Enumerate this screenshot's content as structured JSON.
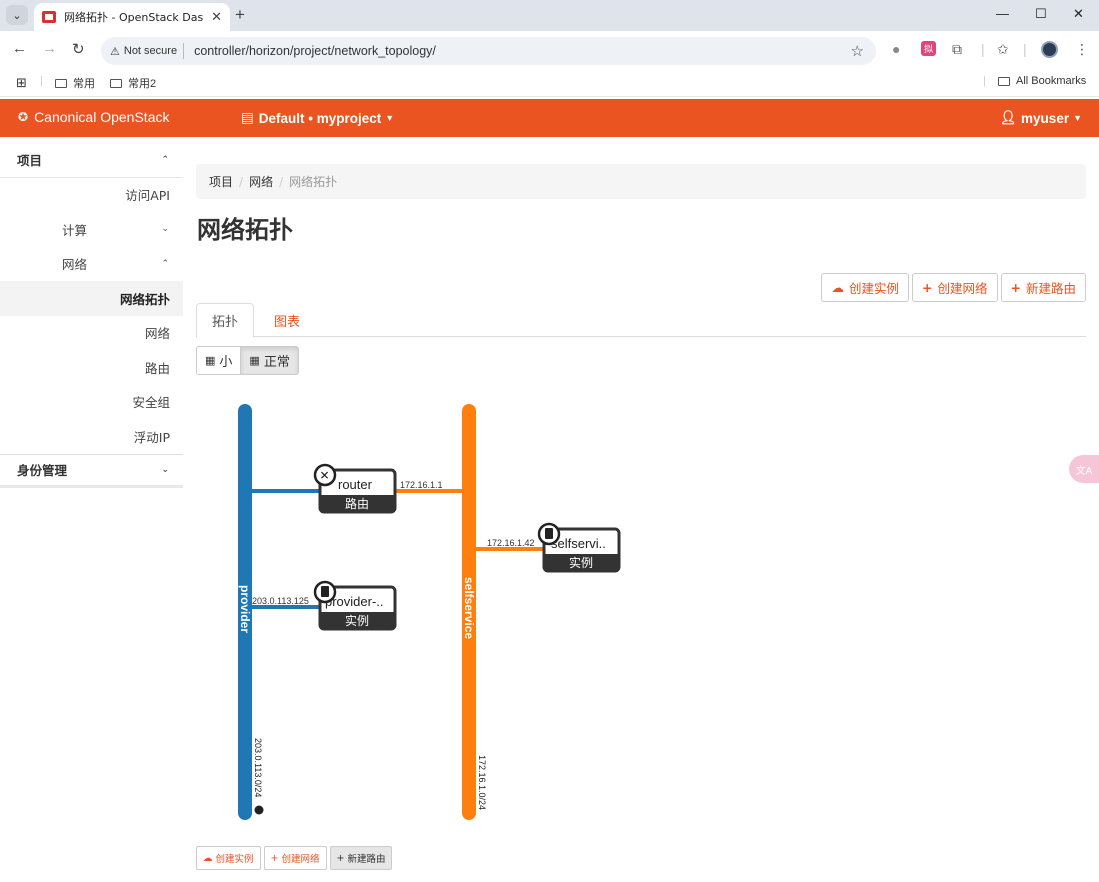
{
  "browser": {
    "tab_title": "网络拓扑 - OpenStack Dashbo",
    "url": "controller/horizon/project/network_topology/",
    "security_label": "Not secure",
    "bookmarks": [
      "常用",
      "常用2"
    ],
    "all_bookmarks": "All Bookmarks",
    "ext_badge": "拟"
  },
  "navbar": {
    "brand": "Canonical OpenStack",
    "project": "Default • myproject",
    "user": "myuser",
    "color": "#e95420"
  },
  "sidebar": {
    "project": "项目",
    "api_access": "访问API",
    "compute": "计算",
    "network": "网络",
    "network_topology": "网络拓扑",
    "networks": "网络",
    "routers": "路由",
    "security_groups": "安全组",
    "floating_ips": "浮动IP",
    "identity": "身份管理"
  },
  "breadcrumb": [
    "项目",
    "网络",
    "网络拓扑"
  ],
  "page_title": "网络拓扑",
  "actions": {
    "create_instance": "创建实例",
    "create_network": "创建网络",
    "create_router": "新建路由"
  },
  "tabs": {
    "topology": "拓扑",
    "graph": "图表"
  },
  "view_toggle": {
    "small": "小",
    "normal": "正常"
  },
  "topology": {
    "networks": [
      {
        "name": "provider",
        "cidr": "203.0.113.0/24",
        "color": "#1f77b4"
      },
      {
        "name": "selfservice",
        "cidr": "172.16.1.0/24",
        "color": "#ff7f0e"
      }
    ],
    "router": {
      "name": "router",
      "type": "路由",
      "ip": "172.16.1.1"
    },
    "instances": [
      {
        "name": "provider-..",
        "type": "实例",
        "ip": "203.0.113.125"
      },
      {
        "name": "selfservi..",
        "type": "实例",
        "ip": "172.16.1.42"
      }
    ]
  },
  "bottom_actions": {
    "create_instance": "创建实例",
    "create_network": "创建网络",
    "create_router": "新建路由"
  }
}
